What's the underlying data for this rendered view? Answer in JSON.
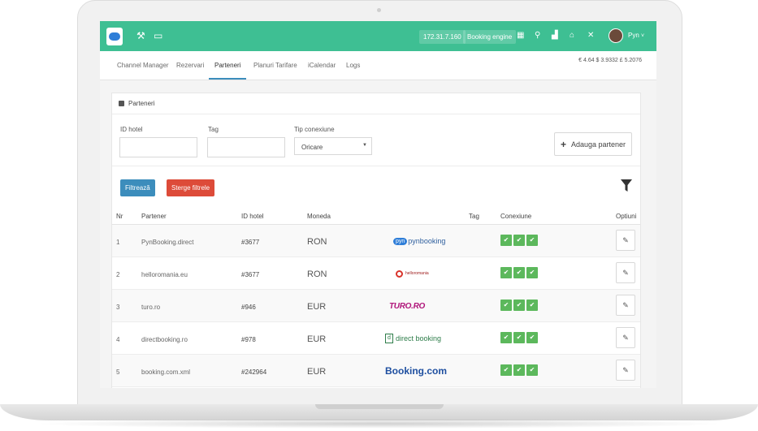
{
  "topbar": {
    "ip_label": "172.31.7.160",
    "booking_engine_label": "Booking engine",
    "user_name": "Pyn",
    "user_caret": "˅"
  },
  "nav": {
    "tabs": [
      "Channel Manager",
      "Rezervari",
      "Parteneri",
      "Planuri Tarifare",
      "iCalendar",
      "Logs"
    ],
    "active_tab": "Parteneri",
    "rates": "€ 4.64 $ 3.9332 £ 5.2076"
  },
  "panel": {
    "title": "Parteneri",
    "filters": {
      "hotel_id_label": "ID hotel",
      "tag_label": "Tag",
      "connection_label": "Tip conexiune",
      "connection_value": "Oricare",
      "hotel_id_value": "",
      "tag_value": ""
    },
    "add_partner_label": "Adauga partener",
    "filter_button_label": "Filtrează",
    "clear_button_label": "Sterge filtrele"
  },
  "table": {
    "headers": {
      "nr": "Nr",
      "partner": "Partener",
      "hotel_id": "ID hotel",
      "currency": "Moneda",
      "tag": "Tag",
      "connection": "Conexiune",
      "options": "Optiuni"
    },
    "rows": [
      {
        "nr": "1",
        "partner": "PynBooking.direct",
        "hotel_id": "#3677",
        "currency": "RON",
        "brand": "pynbooking"
      },
      {
        "nr": "2",
        "partner": "helloromania.eu",
        "hotel_id": "#3677",
        "currency": "RON",
        "brand": "helloromania"
      },
      {
        "nr": "3",
        "partner": "turo.ro",
        "hotel_id": "#946",
        "currency": "EUR",
        "brand": "TURO.RO"
      },
      {
        "nr": "4",
        "partner": "directbooking.ro",
        "hotel_id": "#978",
        "currency": "EUR",
        "brand": "direct booking"
      },
      {
        "nr": "5",
        "partner": "booking.com.xml",
        "hotel_id": "#242964",
        "currency": "EUR",
        "brand": "Booking.com"
      }
    ]
  },
  "colors": {
    "topbar": "#3ebf93",
    "primary": "#3c8dbc",
    "danger": "#dd4b39",
    "success": "#5cb85c"
  }
}
